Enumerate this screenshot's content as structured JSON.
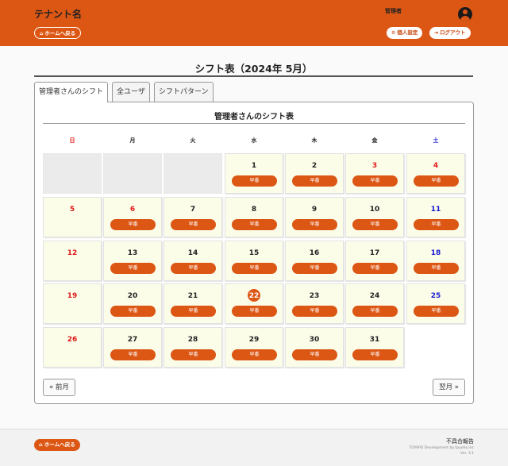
{
  "header": {
    "tenant_name": "テナント名",
    "home_label": "ホームへ戻る",
    "user_name": "管理者",
    "settings_label": "個人設定",
    "logout_label": "ログアウト"
  },
  "page": {
    "title": "シフト表（2024年 5月）"
  },
  "tabs": [
    {
      "label": "管理者さんのシフト",
      "active": true
    },
    {
      "label": "全ユーザ",
      "active": false
    },
    {
      "label": "シフトパターン",
      "active": false
    }
  ],
  "calendar": {
    "title": "管理者さんのシフト表",
    "weekdays": [
      "日",
      "月",
      "火",
      "水",
      "木",
      "金",
      "土"
    ],
    "shift_label": "早番",
    "today": 22,
    "weeks": [
      [
        null,
        null,
        null,
        {
          "d": 1,
          "s": true
        },
        {
          "d": 2,
          "s": true
        },
        {
          "d": 3,
          "s": true,
          "h": true
        },
        {
          "d": 4,
          "s": true,
          "h": true
        }
      ],
      [
        {
          "d": 5,
          "s": false
        },
        {
          "d": 6,
          "s": true,
          "h": true
        },
        {
          "d": 7,
          "s": true
        },
        {
          "d": 8,
          "s": true
        },
        {
          "d": 9,
          "s": true
        },
        {
          "d": 10,
          "s": true
        },
        {
          "d": 11,
          "s": true
        }
      ],
      [
        {
          "d": 12,
          "s": false
        },
        {
          "d": 13,
          "s": true
        },
        {
          "d": 14,
          "s": true
        },
        {
          "d": 15,
          "s": true
        },
        {
          "d": 16,
          "s": true
        },
        {
          "d": 17,
          "s": true
        },
        {
          "d": 18,
          "s": true
        }
      ],
      [
        {
          "d": 19,
          "s": false
        },
        {
          "d": 20,
          "s": true
        },
        {
          "d": 21,
          "s": true
        },
        {
          "d": 22,
          "s": true
        },
        {
          "d": 23,
          "s": true
        },
        {
          "d": 24,
          "s": true
        },
        {
          "d": 25,
          "s": true
        }
      ],
      [
        {
          "d": 26,
          "s": false
        },
        {
          "d": 27,
          "s": true
        },
        {
          "d": 28,
          "s": true
        },
        {
          "d": 29,
          "s": true
        },
        {
          "d": 30,
          "s": true
        },
        {
          "d": 31,
          "s": true
        },
        "none"
      ]
    ],
    "prev_label": "« 前月",
    "next_label": "翌月 »"
  },
  "footer": {
    "home_label": "ホームへ戻る",
    "report_label": "不具合報告",
    "copyright": "TOYAPO Development by tpyoho.inc",
    "version": "Ver. 3.1"
  },
  "colors": {
    "accent": "#dc5614",
    "sunday": "#e01818",
    "saturday": "#1a1ad0",
    "cell_bg": "#fbfde9"
  },
  "icons": {
    "home": "home-icon",
    "settings": "gear-icon",
    "logout": "logout-icon",
    "avatar": "user-circle-icon"
  }
}
